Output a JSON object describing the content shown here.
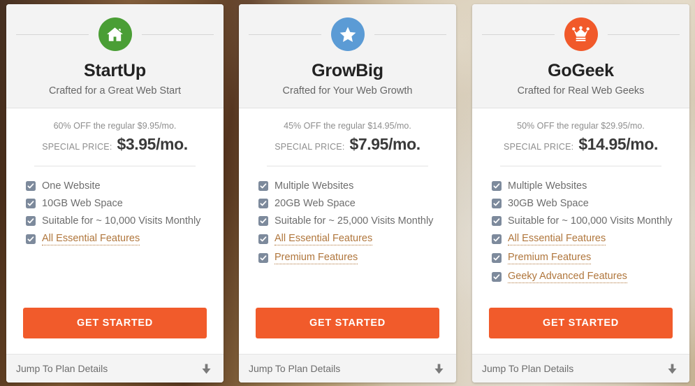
{
  "plans": [
    {
      "icon": "home-icon",
      "icon_color": "#4a9e35",
      "name": "StartUp",
      "tagline": "Crafted for a Great Web Start",
      "regular_line": "60% OFF the regular $9.95/mo.",
      "special_label": "SPECIAL PRICE:",
      "special_price": "$3.95/mo.",
      "features": [
        {
          "text": "One Website",
          "tooltip": false
        },
        {
          "text": "10GB Web Space",
          "tooltip": false
        },
        {
          "text": "Suitable for ~ 10,000 Visits Monthly",
          "tooltip": false
        },
        {
          "text": "All Essential Features",
          "tooltip": true
        }
      ],
      "cta_label": "Get Started",
      "footer_label": "Jump To Plan Details"
    },
    {
      "icon": "star-icon",
      "icon_color": "#5b9bd5",
      "name": "GrowBig",
      "tagline": "Crafted for Your Web Growth",
      "regular_line": "45% OFF the regular $14.95/mo.",
      "special_label": "SPECIAL PRICE:",
      "special_price": "$7.95/mo.",
      "features": [
        {
          "text": "Multiple Websites",
          "tooltip": false
        },
        {
          "text": "20GB Web Space",
          "tooltip": false
        },
        {
          "text": "Suitable for ~ 25,000 Visits Monthly",
          "tooltip": false
        },
        {
          "text": "All Essential Features",
          "tooltip": true
        },
        {
          "text": "Premium Features",
          "tooltip": true
        }
      ],
      "cta_label": "Get Started",
      "footer_label": "Jump To Plan Details"
    },
    {
      "icon": "crown-icon",
      "icon_color": "#f1592a",
      "name": "GoGeek",
      "tagline": "Crafted for Real Web Geeks",
      "regular_line": "50% OFF the regular $29.95/mo.",
      "special_label": "SPECIAL PRICE:",
      "special_price": "$14.95/mo.",
      "features": [
        {
          "text": "Multiple Websites",
          "tooltip": false
        },
        {
          "text": "30GB Web Space",
          "tooltip": false
        },
        {
          "text": "Suitable for ~ 100,000 Visits Monthly",
          "tooltip": false
        },
        {
          "text": "All Essential Features",
          "tooltip": true
        },
        {
          "text": "Premium Features",
          "tooltip": true
        },
        {
          "text": "Geeky Advanced Features",
          "tooltip": true
        }
      ],
      "cta_label": "Get Started",
      "footer_label": "Jump To Plan Details"
    }
  ],
  "colors": {
    "cta_background": "#f15b2b",
    "cta_text": "#ffffff",
    "checkbox": "#7d8a9c",
    "tooltip_link": "#b0763c",
    "card_header_background": "#f3f3f3",
    "card_footer_background": "#f4f4f4"
  }
}
